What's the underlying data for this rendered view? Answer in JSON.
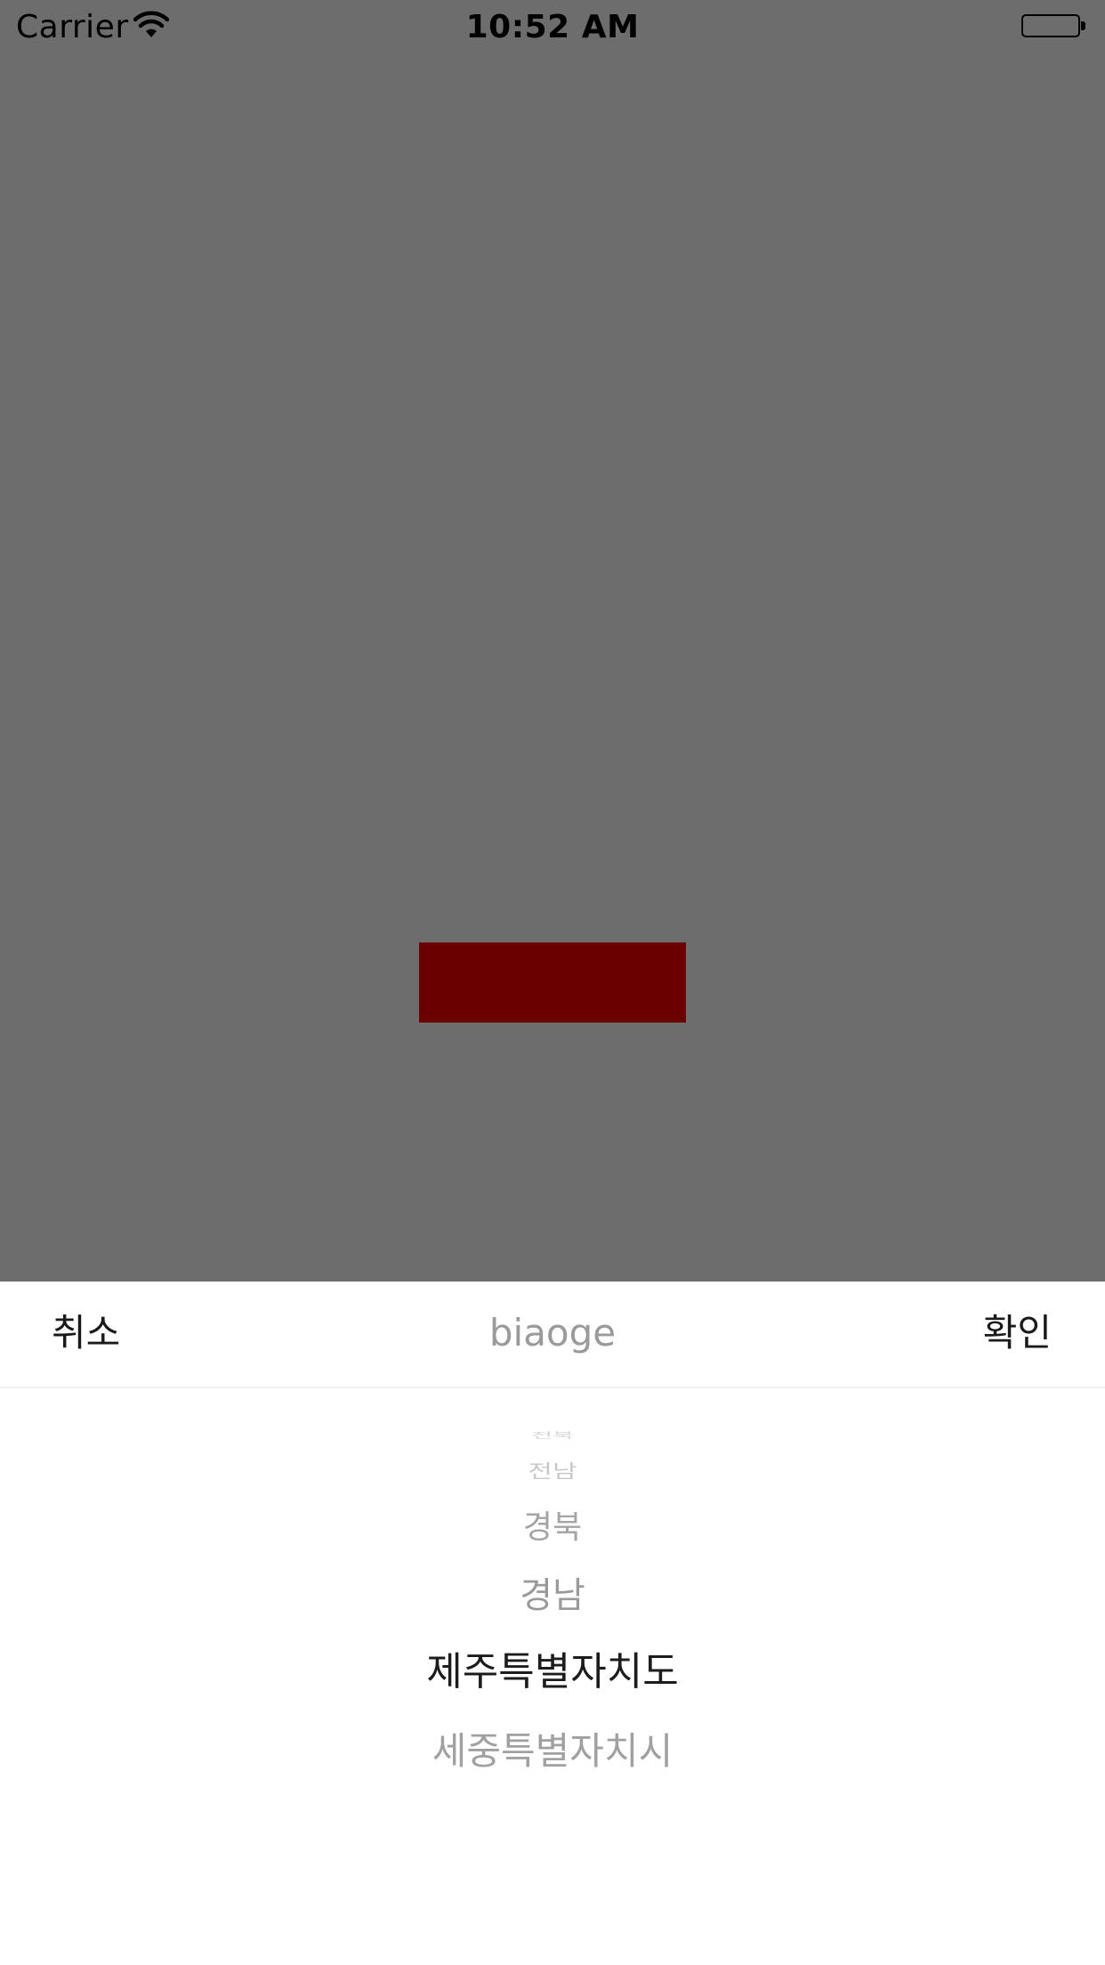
{
  "status_bar": {
    "carrier": "Carrier",
    "time": "10:52 AM",
    "icons": [
      "wifi-icon",
      "battery-icon"
    ]
  },
  "colors": {
    "overlay": "#6d6d6d",
    "red_block": "#6a0000",
    "sheet_bg": "#ffffff"
  },
  "toolbar": {
    "cancel_label": "취소",
    "title": "biaoge",
    "confirm_label": "확인"
  },
  "picker": {
    "items": [
      "전북",
      "전남",
      "경북",
      "경남",
      "제주특별자치도",
      "세중특별자치시"
    ],
    "selected": "제주특별자치도"
  }
}
